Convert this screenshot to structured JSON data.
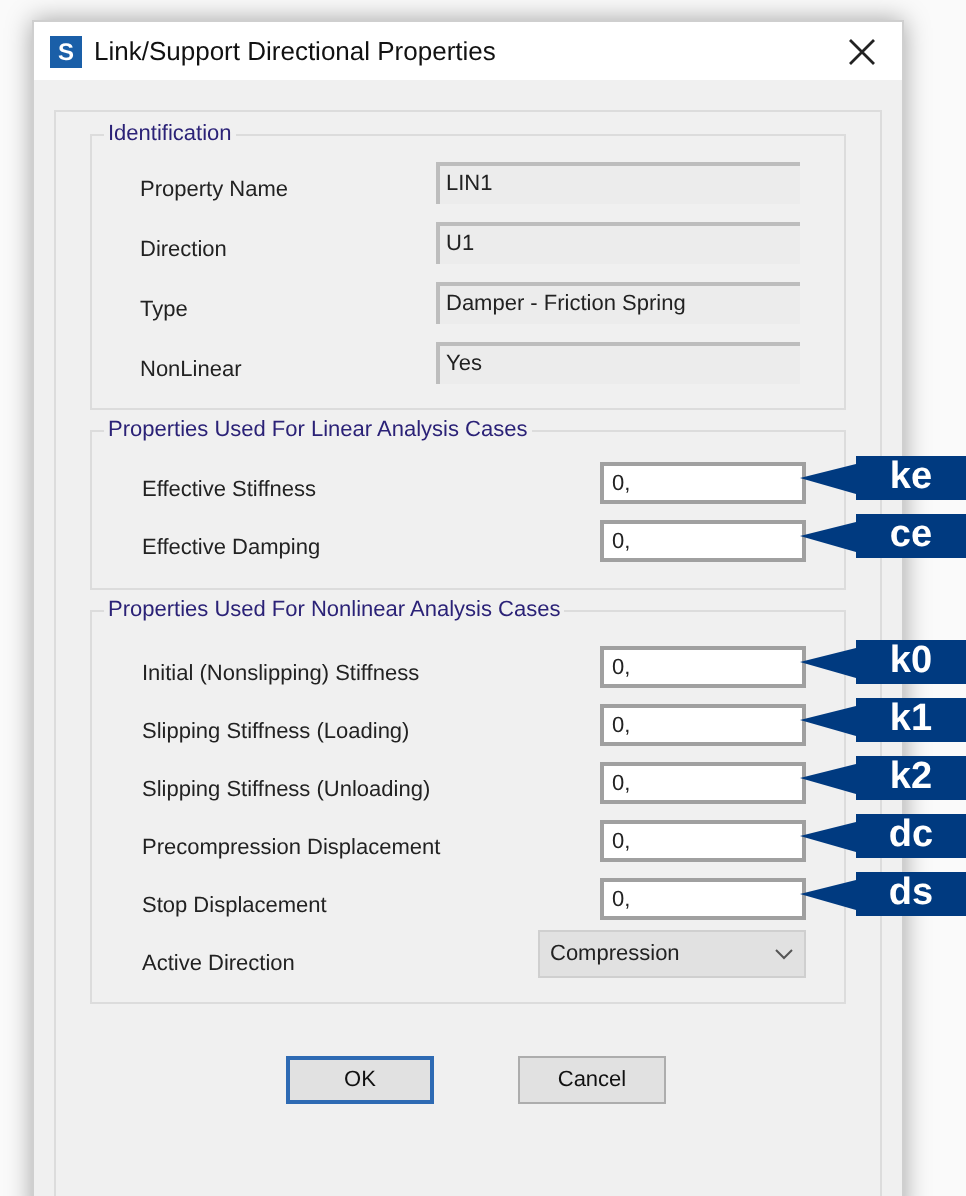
{
  "window": {
    "title": "Link/Support Directional Properties",
    "app_icon": "S"
  },
  "identification": {
    "title": "Identification",
    "fields": [
      {
        "label": "Property Name",
        "value": "LIN1"
      },
      {
        "label": "Direction",
        "value": "U1"
      },
      {
        "label": "Type",
        "value": "Damper - Friction Spring"
      },
      {
        "label": "NonLinear",
        "value": "Yes"
      }
    ]
  },
  "linear": {
    "title": "Properties Used For Linear Analysis Cases",
    "fields": [
      {
        "label": "Effective Stiffness",
        "value": "0,",
        "callout": "ke"
      },
      {
        "label": "Effective Damping",
        "value": "0,",
        "callout": "ce"
      }
    ]
  },
  "nonlinear": {
    "title": "Properties Used For Nonlinear Analysis Cases",
    "fields": [
      {
        "label": "Initial (Nonslipping) Stiffness",
        "value": "0,",
        "callout": "k0"
      },
      {
        "label": "Slipping Stiffness (Loading)",
        "value": "0,",
        "callout": "k1"
      },
      {
        "label": "Slipping Stiffness (Unloading)",
        "value": "0,",
        "callout": "k2"
      },
      {
        "label": "Precompression Displacement",
        "value": "0,",
        "callout": "dc"
      },
      {
        "label": "Stop Displacement",
        "value": "0,",
        "callout": "ds"
      }
    ],
    "active_direction": {
      "label": "Active Direction",
      "value": "Compression"
    }
  },
  "buttons": [
    {
      "label": "OK",
      "default": true
    },
    {
      "label": "Cancel",
      "default": false
    }
  ]
}
